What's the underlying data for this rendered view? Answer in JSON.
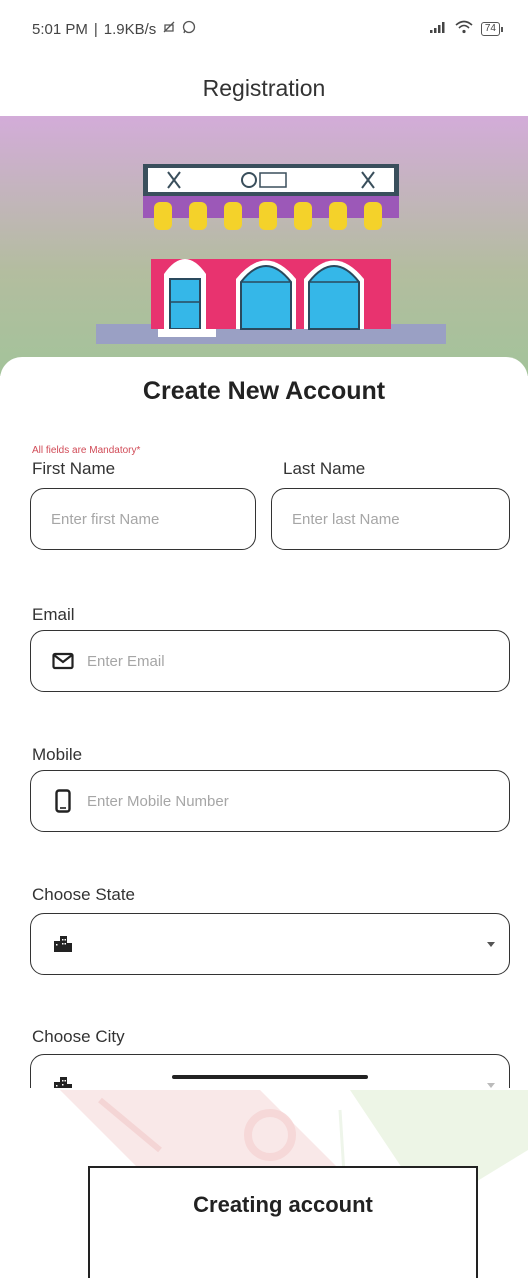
{
  "status_bar": {
    "time": "5:01 PM",
    "separator": "|",
    "speed": "1.9KB/s",
    "battery": "74"
  },
  "app_bar": {
    "title": "Registration"
  },
  "form": {
    "title": "Create New Account",
    "mandatory_note": "All fields are Mandatory*",
    "first_name": {
      "label": "First Name",
      "placeholder": "Enter first Name",
      "value": ""
    },
    "last_name": {
      "label": "Last Name",
      "placeholder": "Enter last Name",
      "value": ""
    },
    "email": {
      "label": "Email",
      "placeholder": "Enter Email",
      "icon": "mail-icon",
      "value": ""
    },
    "mobile": {
      "label": "Mobile",
      "placeholder": "Enter Mobile Number",
      "icon": "phone-icon",
      "value": ""
    },
    "state": {
      "label": "Choose State",
      "icon": "city-icon",
      "value": ""
    },
    "city": {
      "label": "Choose City",
      "icon": "city-icon",
      "value": ""
    }
  },
  "overlay": {
    "message": "Creating account"
  },
  "colors": {
    "hero_top": "#d3acd9",
    "hero_bottom": "#a3c39a",
    "mandatory": "#d14b57",
    "shop_wall": "#e8336f",
    "awning_purple": "#9c58b8",
    "awning_yellow": "#f4d22a",
    "window_blue": "#35b7e8"
  }
}
